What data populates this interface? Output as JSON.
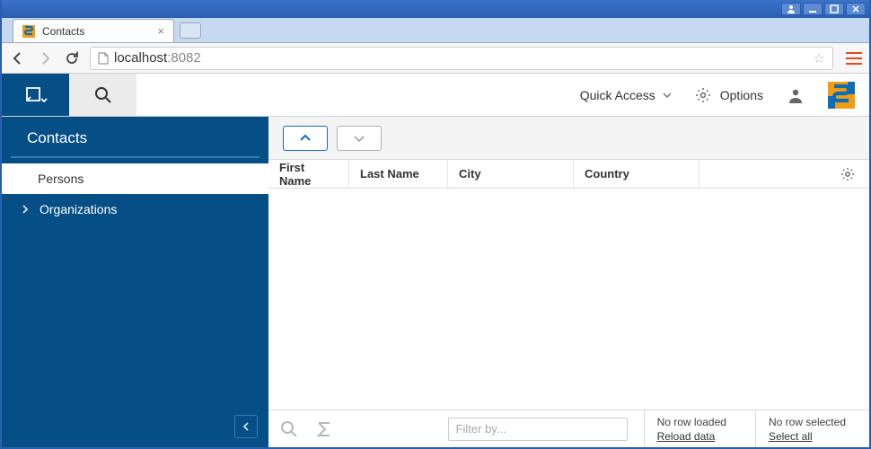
{
  "window": {},
  "browser": {
    "tab_title": "Contacts",
    "url_host": "localhost",
    "url_port": ":8082"
  },
  "toolbar": {
    "quick_access": "Quick Access",
    "options": "Options"
  },
  "sidebar": {
    "title": "Contacts",
    "items": [
      {
        "label": "Persons",
        "active": true
      },
      {
        "label": "Organizations",
        "active": false
      }
    ]
  },
  "table": {
    "columns": [
      "First Name",
      "Last Name",
      "City",
      "Country"
    ],
    "rows": []
  },
  "footer": {
    "filter_placeholder": "Filter by...",
    "status_load": "No row loaded",
    "reload": "Reload data",
    "status_select": "No row selected",
    "select_all": "Select all"
  }
}
